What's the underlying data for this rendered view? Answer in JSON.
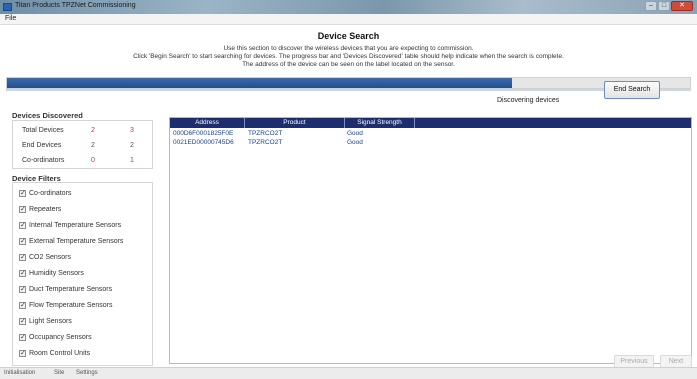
{
  "window": {
    "title": "Titan Products TPZNet Commissioning",
    "controls": {
      "minimize": "–",
      "maximize": "□",
      "close": "✕"
    }
  },
  "menu": {
    "file": "File"
  },
  "page": {
    "heading": "Device Search",
    "instructions": [
      "Use this section to discover the wireless devices that you are expecting to commission.",
      "Click 'Begin Search' to start searching for devices. The progress bar and 'Devices Discovered' table should help indicate when the search is complete.",
      "The address of the device can be seen on the label located on the sensor."
    ]
  },
  "progress": {
    "value": 0.74
  },
  "end_search_label": "End Search",
  "status_text": "Discovering devices",
  "devices_discovered": {
    "title": "Devices Discovered",
    "rows": [
      {
        "label": "Total Devices",
        "a": "2",
        "b": "3"
      },
      {
        "label": "End Devices",
        "a": "2",
        "b": "2"
      },
      {
        "label": "Co-ordinators",
        "a": "0",
        "b": "1"
      }
    ]
  },
  "device_filters": {
    "title": "Device Filters",
    "items": [
      {
        "label": "Co-ordinators",
        "checked": true
      },
      {
        "label": "Repeaters",
        "checked": true
      },
      {
        "label": "Internal Temperature Sensors",
        "checked": true
      },
      {
        "label": "External Temperature Sensors",
        "checked": true
      },
      {
        "label": "CO2 Sensors",
        "checked": true
      },
      {
        "label": "Humidity Sensors",
        "checked": true
      },
      {
        "label": "Duct Temperature Sensors",
        "checked": true
      },
      {
        "label": "Flow Temperature Sensors",
        "checked": true
      },
      {
        "label": "Light Sensors",
        "checked": true
      },
      {
        "label": "Occupancy Sensors",
        "checked": true
      },
      {
        "label": "Room Control Units",
        "checked": true
      }
    ]
  },
  "table": {
    "columns": [
      "Address",
      "Product",
      "Signal Strength"
    ],
    "rows": [
      [
        "000D6F0001825F0E",
        "TPZRCO2T",
        "Good"
      ],
      [
        "0021ED00000745D6",
        "TPZRCO2T",
        "Good"
      ]
    ]
  },
  "nav": {
    "previous": "Previous",
    "next": "Next"
  },
  "statusbar": {
    "tabs": [
      "Initialisation",
      "Site",
      "Settings"
    ]
  }
}
